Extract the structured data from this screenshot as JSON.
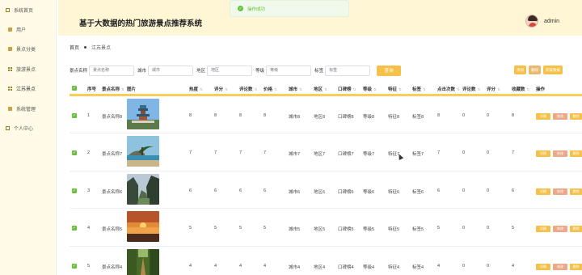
{
  "sidebar": {
    "items": [
      {
        "label": "系统首页",
        "icon": "square-icon"
      },
      {
        "label": "用户",
        "icon": "square-fill-icon"
      },
      {
        "label": "景点分类",
        "icon": "square-fill-icon"
      },
      {
        "label": "旅游景点",
        "icon": "grid-icon"
      },
      {
        "label": "江苏景点",
        "icon": "grid-icon"
      },
      {
        "label": "系统管理",
        "icon": "square-fill-icon"
      },
      {
        "label": "个人中心",
        "icon": "square-icon"
      }
    ]
  },
  "header": {
    "title": "基于大数据的热门旅游景点推荐系统",
    "username": "admin"
  },
  "toast": {
    "text": "操作成功"
  },
  "breadcrumb": {
    "home": "首页",
    "current": "江苏景点"
  },
  "search": {
    "fields": [
      {
        "label": "景点名称",
        "placeholder": "景点名称"
      },
      {
        "label": "城市",
        "placeholder": "城市"
      },
      {
        "label": "地区",
        "placeholder": "地区"
      },
      {
        "label": "等级",
        "placeholder": "等级"
      },
      {
        "label": "标签",
        "placeholder": "标签"
      }
    ],
    "query_label": "查询"
  },
  "ops": {
    "add": "添加",
    "delete": "删除",
    "crawl": "爬取数据"
  },
  "table": {
    "headers": [
      "序号",
      "景点名称",
      "图片",
      "热度",
      "评分",
      "评论数",
      "价格",
      "城市",
      "地区",
      "口碑榜",
      "等级",
      "特征",
      "标签",
      "点击次数",
      "评论数",
      "评分",
      "收藏数",
      "操作"
    ],
    "rows": [
      {
        "index": "1",
        "name": "景点名称8",
        "heat": "8",
        "score": "8",
        "comments": "8",
        "price": "8",
        "city": "城市8",
        "area": "地区8",
        "rank": "口碑榜8",
        "level": "等级8",
        "feature": "特征8",
        "tag": "标签8",
        "clicks": "8",
        "comment_count": "0",
        "rating": "0",
        "favorites": "8"
      },
      {
        "index": "2",
        "name": "景点名称7",
        "heat": "7",
        "score": "7",
        "comments": "7",
        "price": "7",
        "city": "城市7",
        "area": "地区7",
        "rank": "口碑榜7",
        "level": "等级7",
        "feature": "特征7",
        "tag": "标签7",
        "clicks": "7",
        "comment_count": "0",
        "rating": "0",
        "favorites": "7"
      },
      {
        "index": "3",
        "name": "景点名称6",
        "heat": "6",
        "score": "6",
        "comments": "6",
        "price": "6",
        "city": "城市6",
        "area": "地区6",
        "rank": "口碑榜6",
        "level": "等级6",
        "feature": "特征6",
        "tag": "标签6",
        "clicks": "6",
        "comment_count": "0",
        "rating": "0",
        "favorites": "6"
      },
      {
        "index": "4",
        "name": "景点名称5",
        "heat": "5",
        "score": "5",
        "comments": "5",
        "price": "5",
        "city": "城市5",
        "area": "地区5",
        "rank": "口碑榜5",
        "level": "等级5",
        "feature": "特征5",
        "tag": "标签5",
        "clicks": "5",
        "comment_count": "0",
        "rating": "0",
        "favorites": "5"
      },
      {
        "index": "5",
        "name": "景点名称4",
        "heat": "4",
        "score": "4",
        "comments": "4",
        "price": "4",
        "city": "城市4",
        "area": "地区4",
        "rank": "口碑榜4",
        "level": "等级4",
        "feature": "特征4",
        "tag": "标签4",
        "clicks": "4",
        "comment_count": "0",
        "rating": "0",
        "favorites": "4"
      }
    ],
    "row_actions": {
      "detail": "详情",
      "edit": "修改",
      "delete": "删除"
    }
  },
  "colors": {
    "accent": "#f5c14a",
    "sidebar_bg": "#fffbe6",
    "header_bg": "#fff6d6",
    "check": "#67c23a"
  }
}
